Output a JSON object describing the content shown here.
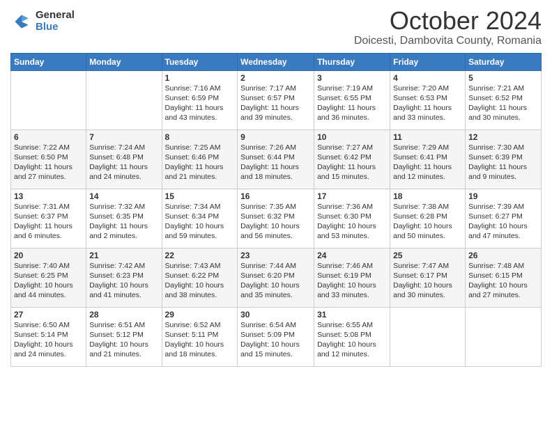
{
  "header": {
    "logo_general": "General",
    "logo_blue": "Blue",
    "month_title": "October 2024",
    "location": "Doicesti, Dambovita County, Romania"
  },
  "days_of_week": [
    "Sunday",
    "Monday",
    "Tuesday",
    "Wednesday",
    "Thursday",
    "Friday",
    "Saturday"
  ],
  "weeks": [
    [
      {
        "day": "",
        "info": ""
      },
      {
        "day": "",
        "info": ""
      },
      {
        "day": "1",
        "info": "Sunrise: 7:16 AM\nSunset: 6:59 PM\nDaylight: 11 hours and 43 minutes."
      },
      {
        "day": "2",
        "info": "Sunrise: 7:17 AM\nSunset: 6:57 PM\nDaylight: 11 hours and 39 minutes."
      },
      {
        "day": "3",
        "info": "Sunrise: 7:19 AM\nSunset: 6:55 PM\nDaylight: 11 hours and 36 minutes."
      },
      {
        "day": "4",
        "info": "Sunrise: 7:20 AM\nSunset: 6:53 PM\nDaylight: 11 hours and 33 minutes."
      },
      {
        "day": "5",
        "info": "Sunrise: 7:21 AM\nSunset: 6:52 PM\nDaylight: 11 hours and 30 minutes."
      }
    ],
    [
      {
        "day": "6",
        "info": "Sunrise: 7:22 AM\nSunset: 6:50 PM\nDaylight: 11 hours and 27 minutes."
      },
      {
        "day": "7",
        "info": "Sunrise: 7:24 AM\nSunset: 6:48 PM\nDaylight: 11 hours and 24 minutes."
      },
      {
        "day": "8",
        "info": "Sunrise: 7:25 AM\nSunset: 6:46 PM\nDaylight: 11 hours and 21 minutes."
      },
      {
        "day": "9",
        "info": "Sunrise: 7:26 AM\nSunset: 6:44 PM\nDaylight: 11 hours and 18 minutes."
      },
      {
        "day": "10",
        "info": "Sunrise: 7:27 AM\nSunset: 6:42 PM\nDaylight: 11 hours and 15 minutes."
      },
      {
        "day": "11",
        "info": "Sunrise: 7:29 AM\nSunset: 6:41 PM\nDaylight: 11 hours and 12 minutes."
      },
      {
        "day": "12",
        "info": "Sunrise: 7:30 AM\nSunset: 6:39 PM\nDaylight: 11 hours and 9 minutes."
      }
    ],
    [
      {
        "day": "13",
        "info": "Sunrise: 7:31 AM\nSunset: 6:37 PM\nDaylight: 11 hours and 6 minutes."
      },
      {
        "day": "14",
        "info": "Sunrise: 7:32 AM\nSunset: 6:35 PM\nDaylight: 11 hours and 2 minutes."
      },
      {
        "day": "15",
        "info": "Sunrise: 7:34 AM\nSunset: 6:34 PM\nDaylight: 10 hours and 59 minutes."
      },
      {
        "day": "16",
        "info": "Sunrise: 7:35 AM\nSunset: 6:32 PM\nDaylight: 10 hours and 56 minutes."
      },
      {
        "day": "17",
        "info": "Sunrise: 7:36 AM\nSunset: 6:30 PM\nDaylight: 10 hours and 53 minutes."
      },
      {
        "day": "18",
        "info": "Sunrise: 7:38 AM\nSunset: 6:28 PM\nDaylight: 10 hours and 50 minutes."
      },
      {
        "day": "19",
        "info": "Sunrise: 7:39 AM\nSunset: 6:27 PM\nDaylight: 10 hours and 47 minutes."
      }
    ],
    [
      {
        "day": "20",
        "info": "Sunrise: 7:40 AM\nSunset: 6:25 PM\nDaylight: 10 hours and 44 minutes."
      },
      {
        "day": "21",
        "info": "Sunrise: 7:42 AM\nSunset: 6:23 PM\nDaylight: 10 hours and 41 minutes."
      },
      {
        "day": "22",
        "info": "Sunrise: 7:43 AM\nSunset: 6:22 PM\nDaylight: 10 hours and 38 minutes."
      },
      {
        "day": "23",
        "info": "Sunrise: 7:44 AM\nSunset: 6:20 PM\nDaylight: 10 hours and 35 minutes."
      },
      {
        "day": "24",
        "info": "Sunrise: 7:46 AM\nSunset: 6:19 PM\nDaylight: 10 hours and 33 minutes."
      },
      {
        "day": "25",
        "info": "Sunrise: 7:47 AM\nSunset: 6:17 PM\nDaylight: 10 hours and 30 minutes."
      },
      {
        "day": "26",
        "info": "Sunrise: 7:48 AM\nSunset: 6:15 PM\nDaylight: 10 hours and 27 minutes."
      }
    ],
    [
      {
        "day": "27",
        "info": "Sunrise: 6:50 AM\nSunset: 5:14 PM\nDaylight: 10 hours and 24 minutes."
      },
      {
        "day": "28",
        "info": "Sunrise: 6:51 AM\nSunset: 5:12 PM\nDaylight: 10 hours and 21 minutes."
      },
      {
        "day": "29",
        "info": "Sunrise: 6:52 AM\nSunset: 5:11 PM\nDaylight: 10 hours and 18 minutes."
      },
      {
        "day": "30",
        "info": "Sunrise: 6:54 AM\nSunset: 5:09 PM\nDaylight: 10 hours and 15 minutes."
      },
      {
        "day": "31",
        "info": "Sunrise: 6:55 AM\nSunset: 5:08 PM\nDaylight: 10 hours and 12 minutes."
      },
      {
        "day": "",
        "info": ""
      },
      {
        "day": "",
        "info": ""
      }
    ]
  ]
}
